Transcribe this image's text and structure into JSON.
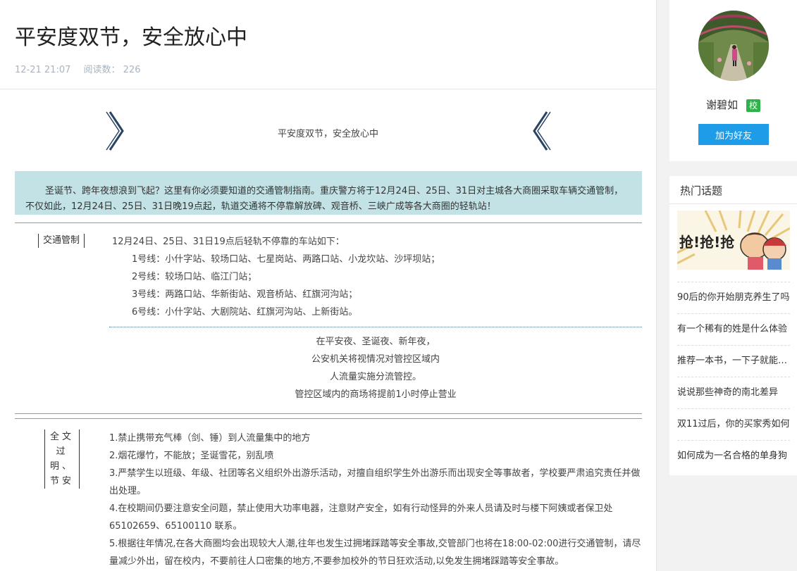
{
  "article": {
    "title": "平安度双节，安全放心中",
    "date": "12-21 21:07",
    "read_label": "阅读数：",
    "read_count": "226",
    "banner_left": "》",
    "banner_right": "《",
    "banner_text": "平安度双节，安全放心中",
    "intro": "圣诞节、跨年夜想浪到飞起？这里有你必须要知道的交通管制指南。重庆警方将于12月24日、25日、31日对主城各大商圈采取车辆交通管制，不仅如此，12月24日、25日、31日晚19点起，轨道交通将不停靠解放碑、观音桥、三峡广成等各大商圈的轻轨站！",
    "section1": {
      "tag": "交通管制",
      "lines": [
        "12月24日、25日、31日19点后轻轨不停靠的车站如下：",
        "1号线：小什字站、较场口站、七星岗站、两路口站、小龙坎站、沙坪坝站；",
        "2号线：较场口站、临江门站；",
        "3号线：两路口站、华新街站、观音桥站、红旗河沟站；",
        "6号线：小什字站、大剧院站、红旗河沟站、上新街站。"
      ],
      "notice": [
        "在平安夜、圣诞夜、新年夜，",
        "公安机关将视情况对管控区域内",
        "人流量实施分流管控。",
        "管控区域内的商场将提前1小时停止营业"
      ]
    },
    "section2": {
      "tag_lines": [
        "全文",
        "过明、",
        "节安"
      ],
      "rules": [
        "1.禁止携带充气棒（剑、锤）到人流量集中的地方",
        "2.烟花爆竹，不能放；圣诞雪花，别乱喷",
        "3.严禁学生以班级、年级、社团等名义组织外出游乐活动，对擅自组织学生外出游乐而出现安全等事故者，学校要严肃追究责任并做出处理。",
        "4.在校期间仍要注意安全问题，禁止使用大功率电器，注意财产安全，如有行动怪异的外来人员请及时与楼下阿姨或者保卫处65102659、65100110 联系。",
        "5.根据往年情况,在各大商圈均会出现较大人潮,往年也发生过拥堵踩踏等安全事故,交管部门也将在18:00-02:00进行交通管制，请尽量减少外出，留在校内，不要前往人口密集的地方,不要参加校外的节日狂欢活动,以免发生拥堵踩踏等安全事故。"
      ]
    }
  },
  "sidebar": {
    "username": "谢碧如",
    "badge": "校",
    "add_friend": "加为好友",
    "hot_title": "热门话题",
    "hot_image_text": "抢!抢!抢",
    "hot_topics": [
      "90后的你开始朋克养生了吗",
      "有一个稀有的姓是什么体验",
      "推荐一本书，一下子就能读完",
      "说说那些神奇的南北差异",
      "双11过后，你的买家秀如何",
      "如何成为一名合格的单身狗"
    ]
  },
  "colors": {
    "intro_bg": "#c2e2e5",
    "button_bg": "#1f9ce8",
    "badge_bg": "#2db34a",
    "banner_mark": "#2a4463"
  }
}
